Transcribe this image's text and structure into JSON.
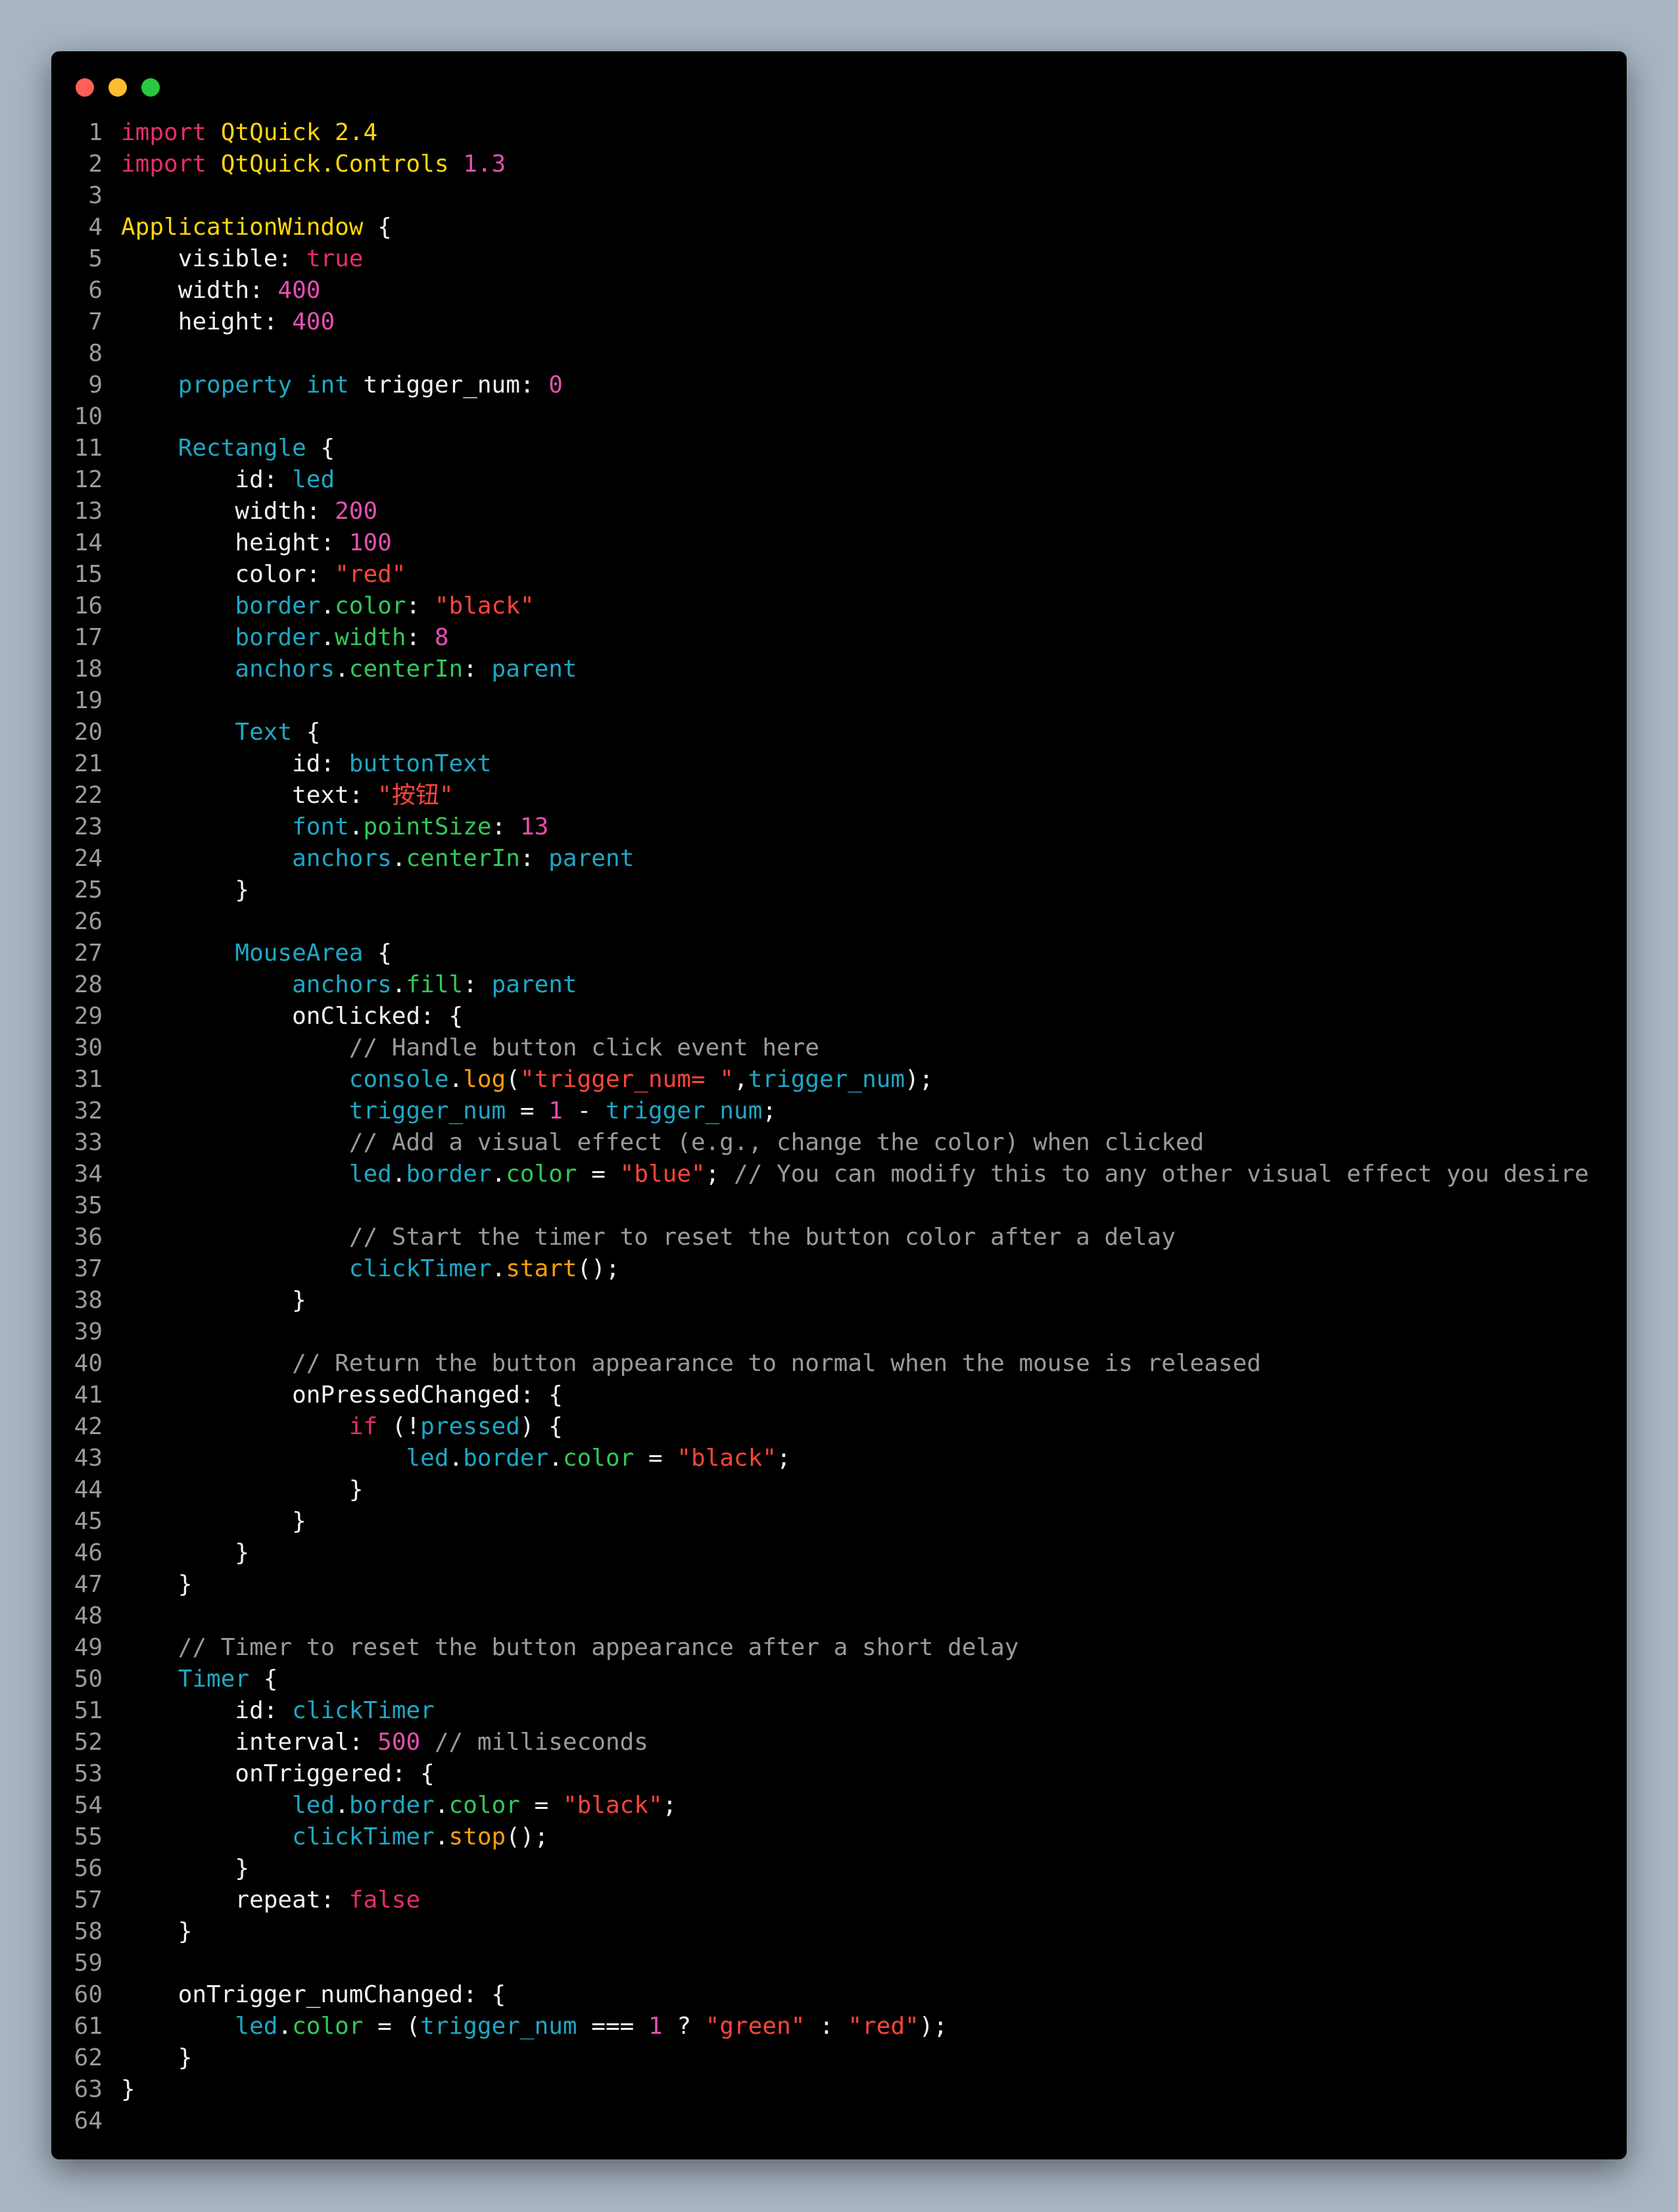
{
  "colors": {
    "background": "#a8b4c2",
    "editor_background": "#000000",
    "line_number": "#9a9a9a",
    "keyword": "#e62c6d",
    "type": "#ffd60a",
    "number": "#e64fb0",
    "identifier_blue": "#1fa7c4",
    "member_green": "#34c759",
    "function_orange": "#ff9f0a",
    "string": "#ff453a",
    "comment": "#9a9a9a",
    "text": "#f2f2f2"
  },
  "window_controls": [
    "close-dot",
    "minimize-dot",
    "zoom-dot"
  ],
  "code_lines": [
    [
      [
        "kw",
        "import"
      ],
      [
        "plain",
        " "
      ],
      [
        "type",
        "QtQuick"
      ],
      [
        "plain",
        " "
      ],
      [
        "type",
        "2.4"
      ]
    ],
    [
      [
        "kw",
        "import"
      ],
      [
        "plain",
        " "
      ],
      [
        "type",
        "QtQuick.Controls"
      ],
      [
        "plain",
        " "
      ],
      [
        "num",
        "1.3"
      ]
    ],
    [],
    [
      [
        "type",
        "ApplicationWindow"
      ],
      [
        "plain",
        " {"
      ]
    ],
    [
      [
        "plain",
        "    visible: "
      ],
      [
        "bool",
        "true"
      ]
    ],
    [
      [
        "plain",
        "    width: "
      ],
      [
        "num",
        "400"
      ]
    ],
    [
      [
        "plain",
        "    height: "
      ],
      [
        "num",
        "400"
      ]
    ],
    [],
    [
      [
        "plain",
        "    "
      ],
      [
        "blue",
        "property"
      ],
      [
        "plain",
        " "
      ],
      [
        "blue",
        "int"
      ],
      [
        "plain",
        " trigger_num: "
      ],
      [
        "num",
        "0"
      ]
    ],
    [],
    [
      [
        "plain",
        "    "
      ],
      [
        "blue",
        "Rectangle"
      ],
      [
        "plain",
        " {"
      ]
    ],
    [
      [
        "plain",
        "        id: "
      ],
      [
        "blue",
        "led"
      ]
    ],
    [
      [
        "plain",
        "        width: "
      ],
      [
        "num",
        "200"
      ]
    ],
    [
      [
        "plain",
        "        height: "
      ],
      [
        "num",
        "100"
      ]
    ],
    [
      [
        "plain",
        "        color: "
      ],
      [
        "str",
        "\"red\""
      ]
    ],
    [
      [
        "plain",
        "        "
      ],
      [
        "blue",
        "border"
      ],
      [
        "plain",
        "."
      ],
      [
        "green",
        "color"
      ],
      [
        "plain",
        ": "
      ],
      [
        "str",
        "\"black\""
      ]
    ],
    [
      [
        "plain",
        "        "
      ],
      [
        "blue",
        "border"
      ],
      [
        "plain",
        "."
      ],
      [
        "green",
        "width"
      ],
      [
        "plain",
        ": "
      ],
      [
        "num",
        "8"
      ]
    ],
    [
      [
        "plain",
        "        "
      ],
      [
        "blue",
        "anchors"
      ],
      [
        "plain",
        "."
      ],
      [
        "green",
        "centerIn"
      ],
      [
        "plain",
        ": "
      ],
      [
        "blue",
        "parent"
      ]
    ],
    [],
    [
      [
        "plain",
        "        "
      ],
      [
        "blue",
        "Text"
      ],
      [
        "plain",
        " {"
      ]
    ],
    [
      [
        "plain",
        "            id: "
      ],
      [
        "blue",
        "buttonText"
      ]
    ],
    [
      [
        "plain",
        "            text: "
      ],
      [
        "str",
        "\"按钮\""
      ]
    ],
    [
      [
        "plain",
        "            "
      ],
      [
        "blue",
        "font"
      ],
      [
        "plain",
        "."
      ],
      [
        "green",
        "pointSize"
      ],
      [
        "plain",
        ": "
      ],
      [
        "num",
        "13"
      ]
    ],
    [
      [
        "plain",
        "            "
      ],
      [
        "blue",
        "anchors"
      ],
      [
        "plain",
        "."
      ],
      [
        "green",
        "centerIn"
      ],
      [
        "plain",
        ": "
      ],
      [
        "blue",
        "parent"
      ]
    ],
    [
      [
        "plain",
        "        }"
      ]
    ],
    [],
    [
      [
        "plain",
        "        "
      ],
      [
        "blue",
        "MouseArea"
      ],
      [
        "plain",
        " {"
      ]
    ],
    [
      [
        "plain",
        "            "
      ],
      [
        "blue",
        "anchors"
      ],
      [
        "plain",
        "."
      ],
      [
        "green",
        "fill"
      ],
      [
        "plain",
        ": "
      ],
      [
        "blue",
        "parent"
      ]
    ],
    [
      [
        "plain",
        "            onClicked: {"
      ]
    ],
    [
      [
        "plain",
        "                "
      ],
      [
        "cm",
        "// Handle button click event here"
      ]
    ],
    [
      [
        "plain",
        "                "
      ],
      [
        "blue",
        "console"
      ],
      [
        "plain",
        "."
      ],
      [
        "orange",
        "log"
      ],
      [
        "plain",
        "("
      ],
      [
        "str",
        "\"trigger_num= \""
      ],
      [
        "plain",
        ","
      ],
      [
        "blue",
        "trigger_num"
      ],
      [
        "plain",
        ");"
      ]
    ],
    [
      [
        "plain",
        "                "
      ],
      [
        "blue",
        "trigger_num"
      ],
      [
        "plain",
        " = "
      ],
      [
        "num",
        "1"
      ],
      [
        "plain",
        " - "
      ],
      [
        "blue",
        "trigger_num"
      ],
      [
        "plain",
        ";"
      ]
    ],
    [
      [
        "plain",
        "                "
      ],
      [
        "cm",
        "// Add a visual effect (e.g., change the color) when clicked"
      ]
    ],
    [
      [
        "plain",
        "                "
      ],
      [
        "blue",
        "led"
      ],
      [
        "plain",
        "."
      ],
      [
        "blue",
        "border"
      ],
      [
        "plain",
        "."
      ],
      [
        "green",
        "color"
      ],
      [
        "plain",
        " = "
      ],
      [
        "str",
        "\"blue\""
      ],
      [
        "plain",
        "; "
      ],
      [
        "cm",
        "// You can modify this to any other visual effect you desire"
      ]
    ],
    [],
    [
      [
        "plain",
        "                "
      ],
      [
        "cm",
        "// Start the timer to reset the button color after a delay"
      ]
    ],
    [
      [
        "plain",
        "                "
      ],
      [
        "blue",
        "clickTimer"
      ],
      [
        "plain",
        "."
      ],
      [
        "orange",
        "start"
      ],
      [
        "plain",
        "();"
      ]
    ],
    [
      [
        "plain",
        "            }"
      ]
    ],
    [],
    [
      [
        "plain",
        "            "
      ],
      [
        "cm",
        "// Return the button appearance to normal when the mouse is released"
      ]
    ],
    [
      [
        "plain",
        "            onPressedChanged: {"
      ]
    ],
    [
      [
        "plain",
        "                "
      ],
      [
        "kw",
        "if"
      ],
      [
        "plain",
        " (!"
      ],
      [
        "blue",
        "pressed"
      ],
      [
        "plain",
        ") {"
      ]
    ],
    [
      [
        "plain",
        "                    "
      ],
      [
        "blue",
        "led"
      ],
      [
        "plain",
        "."
      ],
      [
        "blue",
        "border"
      ],
      [
        "plain",
        "."
      ],
      [
        "green",
        "color"
      ],
      [
        "plain",
        " = "
      ],
      [
        "str",
        "\"black\""
      ],
      [
        "plain",
        ";"
      ]
    ],
    [
      [
        "plain",
        "                }"
      ]
    ],
    [
      [
        "plain",
        "            }"
      ]
    ],
    [
      [
        "plain",
        "        }"
      ]
    ],
    [
      [
        "plain",
        "    }"
      ]
    ],
    [],
    [
      [
        "plain",
        "    "
      ],
      [
        "cm",
        "// Timer to reset the button appearance after a short delay"
      ]
    ],
    [
      [
        "plain",
        "    "
      ],
      [
        "blue",
        "Timer"
      ],
      [
        "plain",
        " {"
      ]
    ],
    [
      [
        "plain",
        "        id: "
      ],
      [
        "blue",
        "clickTimer"
      ]
    ],
    [
      [
        "plain",
        "        interval: "
      ],
      [
        "num",
        "500"
      ],
      [
        "plain",
        " "
      ],
      [
        "cm",
        "// milliseconds"
      ]
    ],
    [
      [
        "plain",
        "        onTriggered: {"
      ]
    ],
    [
      [
        "plain",
        "            "
      ],
      [
        "blue",
        "led"
      ],
      [
        "plain",
        "."
      ],
      [
        "blue",
        "border"
      ],
      [
        "plain",
        "."
      ],
      [
        "green",
        "color"
      ],
      [
        "plain",
        " = "
      ],
      [
        "str",
        "\"black\""
      ],
      [
        "plain",
        ";"
      ]
    ],
    [
      [
        "plain",
        "            "
      ],
      [
        "blue",
        "clickTimer"
      ],
      [
        "plain",
        "."
      ],
      [
        "orange",
        "stop"
      ],
      [
        "plain",
        "();"
      ]
    ],
    [
      [
        "plain",
        "        }"
      ]
    ],
    [
      [
        "plain",
        "        repeat: "
      ],
      [
        "bool",
        "false"
      ]
    ],
    [
      [
        "plain",
        "    }"
      ]
    ],
    [],
    [
      [
        "plain",
        "    onTrigger_numChanged: {"
      ]
    ],
    [
      [
        "plain",
        "        "
      ],
      [
        "blue",
        "led"
      ],
      [
        "plain",
        "."
      ],
      [
        "green",
        "color"
      ],
      [
        "plain",
        " = ("
      ],
      [
        "blue",
        "trigger_num"
      ],
      [
        "plain",
        " === "
      ],
      [
        "num",
        "1"
      ],
      [
        "plain",
        " ? "
      ],
      [
        "str",
        "\"green\""
      ],
      [
        "plain",
        " : "
      ],
      [
        "str",
        "\"red\""
      ],
      [
        "plain",
        ");"
      ]
    ],
    [
      [
        "plain",
        "    }"
      ]
    ],
    [
      [
        "plain",
        "}"
      ]
    ],
    []
  ]
}
